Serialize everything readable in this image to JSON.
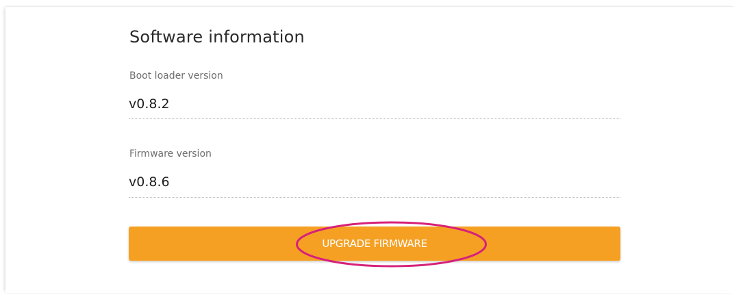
{
  "software_info": {
    "title": "Software information",
    "fields": [
      {
        "label": "Boot loader version",
        "value": "v0.8.2"
      },
      {
        "label": "Firmware version",
        "value": "v0.8.6"
      }
    ],
    "upgrade_button_label": "UPGRADE FIRMWARE"
  },
  "colors": {
    "accent": "#f5a023",
    "annotation": "#d6217a"
  }
}
